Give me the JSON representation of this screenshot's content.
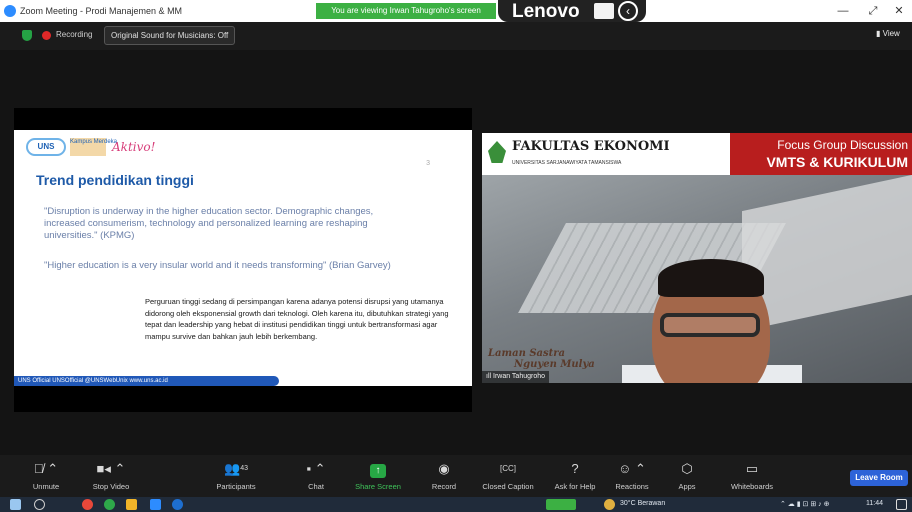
{
  "window": {
    "title": "Zoom Meeting - Prodi Manajemen & MM",
    "viewing_banner": "You are viewing Irwan Tahugroho's screen",
    "overlay_brand": "Lenovo",
    "minimize": "—",
    "restore": "⤢",
    "close": "✕"
  },
  "meeting_bar": {
    "recording_label": "Recording",
    "original_sound": "Original Sound for Musicians: Off",
    "view_button": "View"
  },
  "slide": {
    "logo_uns": "UNS",
    "logo_km": "Kampus Merdeka",
    "logo_aktivo": "Aktivo!",
    "page_marker": "3",
    "title": "Trend pendidikan tinggi",
    "quote1": "\"Disruption is underway in the higher education sector. Demographic changes, increased consumerism, technology and personalized learning are reshaping universities.\" (KPMG)",
    "quote2": "\"Higher education is a very insular world and it needs transforming\" (Brian Garvey)",
    "paragraph": "Perguruan tinggi sedang di persimpangan karena adanya potensi disrupsi yang utamanya didorong oleh eksponensial growth dari teknologi. Oleh karena itu, dibutuhkan strategi yang tepat dan leadership yang hebat di institusi pendidikan tinggi untuk bertransformasi agar mampu survive dan bahkan jauh lebih berkembang.",
    "footer": "UNS Official  UNSOfficial  @UNSWebUnix  www.uns.ac.id"
  },
  "video": {
    "faculty": "FAKULTAS EKONOMI",
    "university": "UNIVERSITAS SARJANAWIYATA TAMANSISWA",
    "fgd_line1": "Focus Group Discussion",
    "fgd_line2": "VMTS & KURIKULUM",
    "signature_line1": "Laman Sastra",
    "signature_line2": "Nguyen Mulya",
    "participant_name": "Irwan Tahugroho"
  },
  "toolbar": {
    "unmute": "Unmute",
    "stop_video": "Stop Video",
    "participants": "Participants",
    "participant_count": "43",
    "chat": "Chat",
    "share_screen": "Share Screen",
    "record": "Record",
    "closed_caption": "Closed Caption",
    "ask_for_help": "Ask for Help",
    "reactions": "Reactions",
    "apps": "Apps",
    "whiteboards": "Whiteboards",
    "leave": "Leave Room"
  },
  "taskbar": {
    "weather": "30°C  Berawan",
    "clock": "11:44"
  }
}
